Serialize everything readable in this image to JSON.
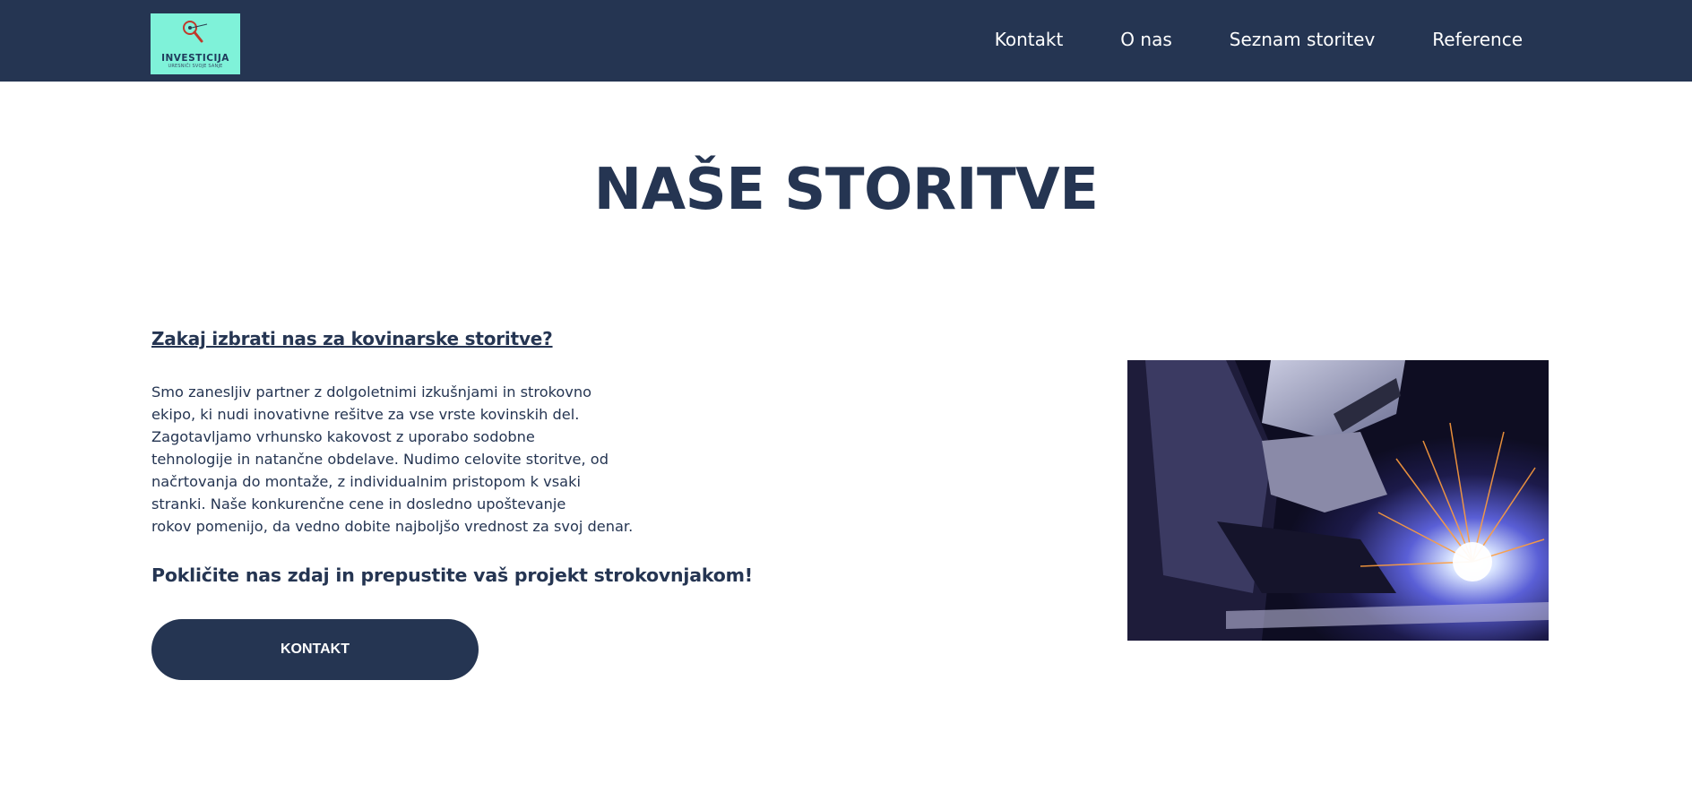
{
  "header": {
    "logo": {
      "name": "INVESTICIJA",
      "tagline": "URESNIČI SVOJE SANJE",
      "background_color": "#7ff2d9"
    },
    "nav": [
      {
        "label": "Kontakt"
      },
      {
        "label": "O nas"
      },
      {
        "label": "Seznam storitev"
      },
      {
        "label": "Reference"
      }
    ],
    "background_color": "#253552"
  },
  "main": {
    "title": "NAŠE STORITVE",
    "section_heading": "Zakaj izbrati nas za kovinarske storitve?",
    "body_lines": [
      "Smo zanesljiv partner z dolgoletnimi izkušnjami in strokovno",
      "ekipo, ki nudi inovativne rešitve za vse vrste kovinskih del.",
      "Zagotavljamo vrhunsko kakovost z uporabo sodobne",
      "tehnologije in natančne obdelave. Nudimo celovite storitve, od",
      "načrtovanja do montaže, z individualnim pristopom k vsaki",
      "stranki. Naše konkurenčne cene in dosledno upoštevanje",
      "rokov pomenijo, da vedno dobite najboljšo vrednost za svoj denar."
    ],
    "cta_text": "Pokličite nas zdaj in prepustite vaš projekt strokovnjakom!",
    "button_label": "KONTAKT",
    "image": {
      "subject": "welder working with sparks",
      "icon": "welding-photo"
    }
  },
  "colors": {
    "accent": "#253552",
    "text": "#253552",
    "background": "#ffffff"
  }
}
